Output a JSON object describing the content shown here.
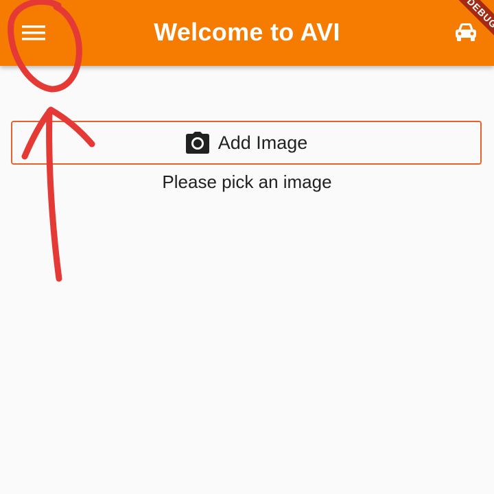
{
  "appbar": {
    "title": "Welcome to AVI",
    "background": "#f57c00",
    "menu_icon": "hamburger-menu-icon",
    "action_icon": "car-icon",
    "debug_banner": "DEBUG"
  },
  "main": {
    "add_button": {
      "label": "Add Image",
      "icon": "camera-icon",
      "border_color": "#e8612c"
    },
    "hint": "Please pick an image"
  },
  "annotation": {
    "color": "#e53935",
    "shapes": [
      "circle",
      "arrow"
    ]
  }
}
